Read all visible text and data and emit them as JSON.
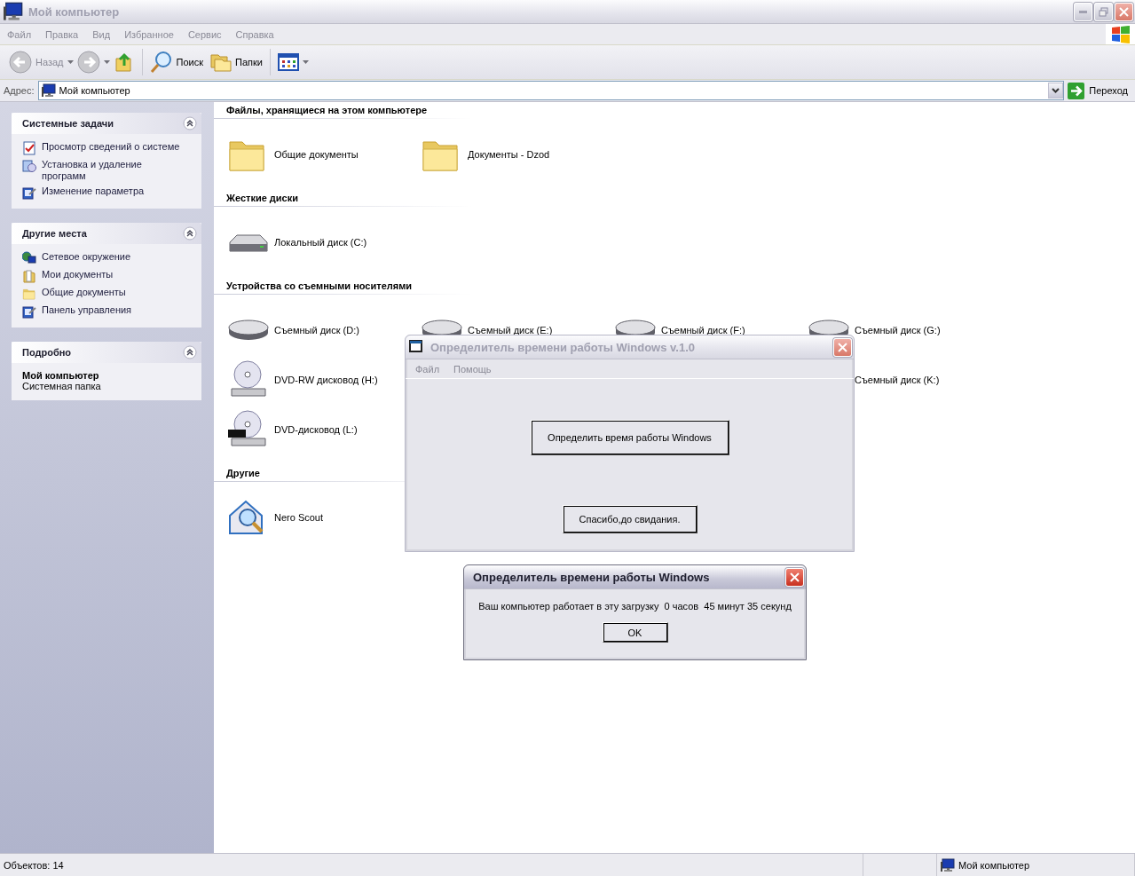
{
  "window": {
    "title": "Мой компьютер",
    "active": false
  },
  "menu": [
    "Файл",
    "Правка",
    "Вид",
    "Избранное",
    "Сервис",
    "Справка"
  ],
  "toolbar": {
    "back": {
      "label": "Назад",
      "disabled": true
    },
    "search": "Поиск",
    "folders": "Папки"
  },
  "address": {
    "label": "Адрес:",
    "value": "Мой компьютер",
    "go": "Переход"
  },
  "sidebar": [
    {
      "kind": "tasks",
      "title": "Системные задачи",
      "expanded": true,
      "items": [
        {
          "label": "Просмотр сведений о системе"
        },
        {
          "label": "Установка и удаление программ"
        },
        {
          "label": "Изменение параметра"
        }
      ]
    },
    {
      "kind": "tasks",
      "title": "Другие места",
      "expanded": true,
      "items": [
        {
          "label": "Сетевое окружение"
        },
        {
          "label": "Мои документы"
        },
        {
          "label": "Общие документы"
        },
        {
          "label": "Панель управления"
        }
      ]
    },
    {
      "kind": "details",
      "title": "Подробно",
      "expanded": true,
      "name": "Мой компьютер",
      "type": "Системная папка"
    }
  ],
  "sections": [
    {
      "heading": "Файлы, хранящиеся на этом компьютере",
      "items": [
        {
          "label": "Общие документы",
          "kind": "folder"
        },
        {
          "label": "Документы - Dzod",
          "kind": "folder"
        }
      ]
    },
    {
      "heading": "Жесткие диски",
      "items": [
        {
          "label": "Локальный диск (C:)",
          "kind": "harddisk"
        }
      ]
    },
    {
      "heading": "Устройства со съемными носителями",
      "items": [
        {
          "label": "Съемный диск (D:)",
          "kind": "removable"
        },
        {
          "label": "Съемный диск (E:)",
          "kind": "removable"
        },
        {
          "label": "Съемный диск (F:)",
          "kind": "removable"
        },
        {
          "label": "Съемный диск (G:)",
          "kind": "removable"
        },
        {
          "label": "DVD-RW дисковод (H:)",
          "kind": "dvdrw"
        },
        {
          "label": "Съемный диск (K:)",
          "kind": "covered"
        },
        {
          "label": "DVD-дисковод (L:)",
          "kind": "dvd"
        }
      ]
    },
    {
      "heading": "Другие",
      "items": [
        {
          "label": "Nero Scout",
          "kind": "nero"
        }
      ]
    }
  ],
  "status_bar": {
    "objects": "Объектов: 14",
    "location": "Мой компьютер"
  },
  "dialogs": [
    {
      "title": "Определитель времени работы Windows v.1.0",
      "active": false,
      "menu": [
        "Файл",
        "Помощь"
      ],
      "buttons": [
        "Определить время работы Windows",
        "Спасибо,до свидания."
      ]
    },
    {
      "title": "Определитель времени работы Windows",
      "active": true,
      "message": "Ваш компьютер работает в эту загрузку  0 часов  45 минут 35 секунд",
      "buttons": [
        "OK"
      ]
    }
  ]
}
